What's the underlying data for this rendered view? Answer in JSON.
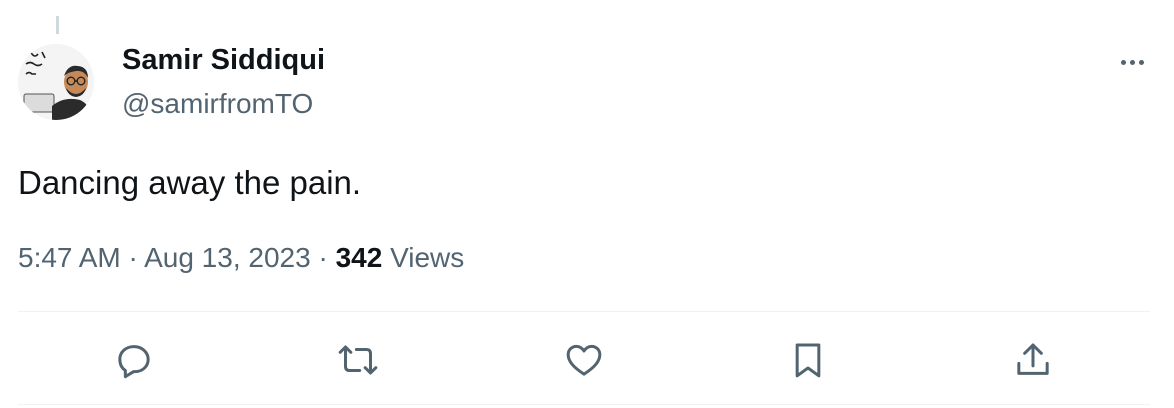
{
  "tweet": {
    "author": {
      "name": "Samir Siddiqui",
      "handle": "@samirfromTO",
      "avatar_icon": "cartoon-avatar-icon"
    },
    "text": "Dancing away the pain.",
    "meta": {
      "time": "5:47 AM",
      "separator": "·",
      "date": "Aug 13, 2023",
      "views_count": "342",
      "views_label": "Views"
    },
    "actions": [
      {
        "name": "reply",
        "icon": "reply-icon"
      },
      {
        "name": "retweet",
        "icon": "retweet-icon"
      },
      {
        "name": "like",
        "icon": "heart-icon"
      },
      {
        "name": "bookmark",
        "icon": "bookmark-icon"
      },
      {
        "name": "share",
        "icon": "share-icon"
      }
    ]
  },
  "colors": {
    "text_primary": "#0f1419",
    "text_secondary": "#536471",
    "divider": "#eff3f4"
  }
}
